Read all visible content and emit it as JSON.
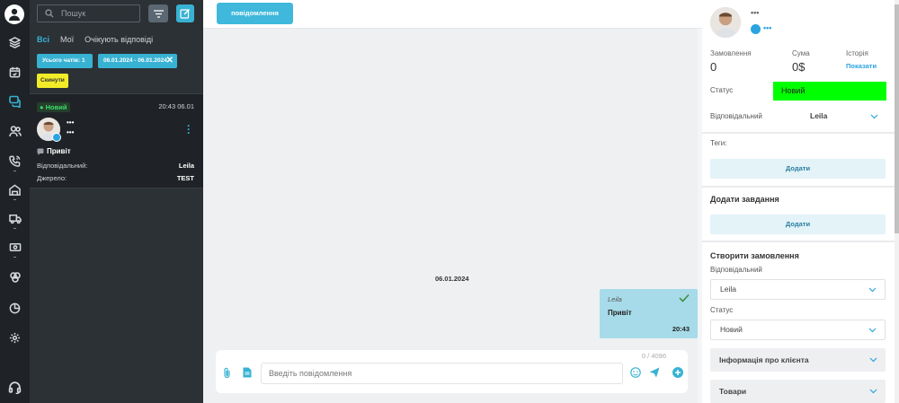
{
  "rail": {
    "items": [
      {
        "icon": "layers-icon"
      },
      {
        "icon": "calendar-icon"
      },
      {
        "icon": "chat-icon"
      },
      {
        "icon": "users-icon"
      },
      {
        "icon": "phone-icon"
      },
      {
        "icon": "warehouse-icon"
      },
      {
        "icon": "truck-icon"
      },
      {
        "icon": "cash-icon"
      },
      {
        "icon": "integrations-icon"
      },
      {
        "icon": "analytics-icon"
      },
      {
        "icon": "settings-icon"
      },
      {
        "icon": "headset-icon"
      }
    ]
  },
  "list": {
    "search_placeholder": "Пошук",
    "tabs": [
      "Всі",
      "Мої",
      "Очікують відповіді"
    ],
    "chip_count": "Усього чатів: 1",
    "chip_date": "06.01.2024 - 06.01.2024",
    "chip_reset": "Скинути",
    "conversation": {
      "status": "Новий",
      "time": "20:43 06.01",
      "name_line1": "•••",
      "name_line2": "•••",
      "last_message": "Привіт",
      "responsible_label": "Відповідальний:",
      "responsible_value": "Leila",
      "source_label": "Джерело:",
      "source_value": "TEST"
    }
  },
  "main": {
    "messages_button": "повідомлення",
    "date_separator": "06.01.2024",
    "bubble": {
      "author": "Leila",
      "text": "Привіт",
      "time": "20:43"
    },
    "counter": "0 / 4096",
    "input_placeholder": "Введіть повідомлення"
  },
  "right": {
    "name": "•••",
    "name_secondary": "•••",
    "orders_label": "Замовлення",
    "orders_value": "0",
    "sum_label": "Сума",
    "sum_value": "0$",
    "history_label": "Історія",
    "history_link": "Показати",
    "status_label": "Статус",
    "status_value": "Новий",
    "responsible_label": "Відповідальний",
    "responsible_value": "Leila",
    "tags_label": "Теги:",
    "add_tag_button": "Додати",
    "add_task_title": "Додати завдання",
    "add_task_button": "Додати",
    "create_order_title": "Створити замовлення",
    "order_responsible_label": "Відповідальний",
    "order_responsible_value": "Leila",
    "order_status_label": "Статус",
    "order_status_value": "Новий",
    "client_info": "Інформація про клієнта",
    "products": "Товари"
  },
  "colors": {
    "accent": "#38b2d3",
    "status_green": "#00ff00",
    "reset_yellow": "#f2ec28",
    "sidebar": "#1f2327"
  }
}
